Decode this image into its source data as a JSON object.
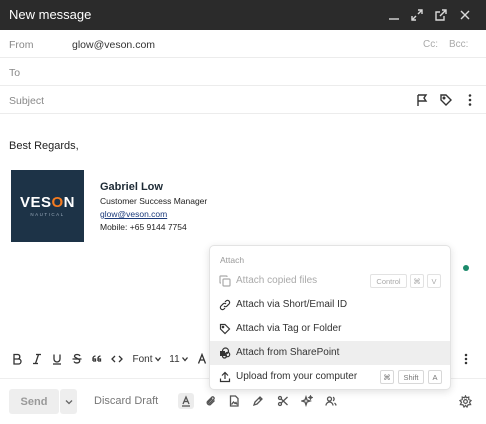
{
  "window": {
    "title": "New message"
  },
  "fields": {
    "from_label": "From",
    "from_value": "glow@veson.com",
    "cc_label": "Cc:",
    "bcc_label": "Bcc:",
    "to_label": "To",
    "subject_label": "Subject"
  },
  "body": {
    "greeting": "Best Regards,",
    "signature": {
      "logo_text_before": "VES",
      "logo_text_o": "O",
      "logo_text_after": "N",
      "logo_subtext": "NAUTICAL",
      "name": "Gabriel Low",
      "title": "Customer Success Manager",
      "email": "glow@veson.com",
      "mobile": "Mobile: +65 9144 7754"
    }
  },
  "toolbar": {
    "font_label": "Font",
    "size_label": "11"
  },
  "bottom": {
    "send_label": "Send",
    "discard_label": "Discard Draft"
  },
  "attach_menu": {
    "header": "Attach",
    "items": [
      {
        "label": "Attach copied files",
        "icon": "copy-icon",
        "disabled": true,
        "shortcut": [
          "Control",
          "⌘",
          "V"
        ]
      },
      {
        "label": "Attach via Short/Email ID",
        "icon": "link-icon",
        "disabled": false,
        "shortcut": []
      },
      {
        "label": "Attach via Tag or Folder",
        "icon": "tag-icon",
        "disabled": false,
        "shortcut": []
      },
      {
        "label": "Attach from SharePoint",
        "icon": "sharepoint-icon",
        "disabled": false,
        "active": true,
        "shortcut": []
      },
      {
        "label": "Upload from your computer",
        "icon": "upload-icon",
        "disabled": false,
        "shortcut": [
          "⌘",
          "Shift",
          "A"
        ]
      }
    ]
  }
}
